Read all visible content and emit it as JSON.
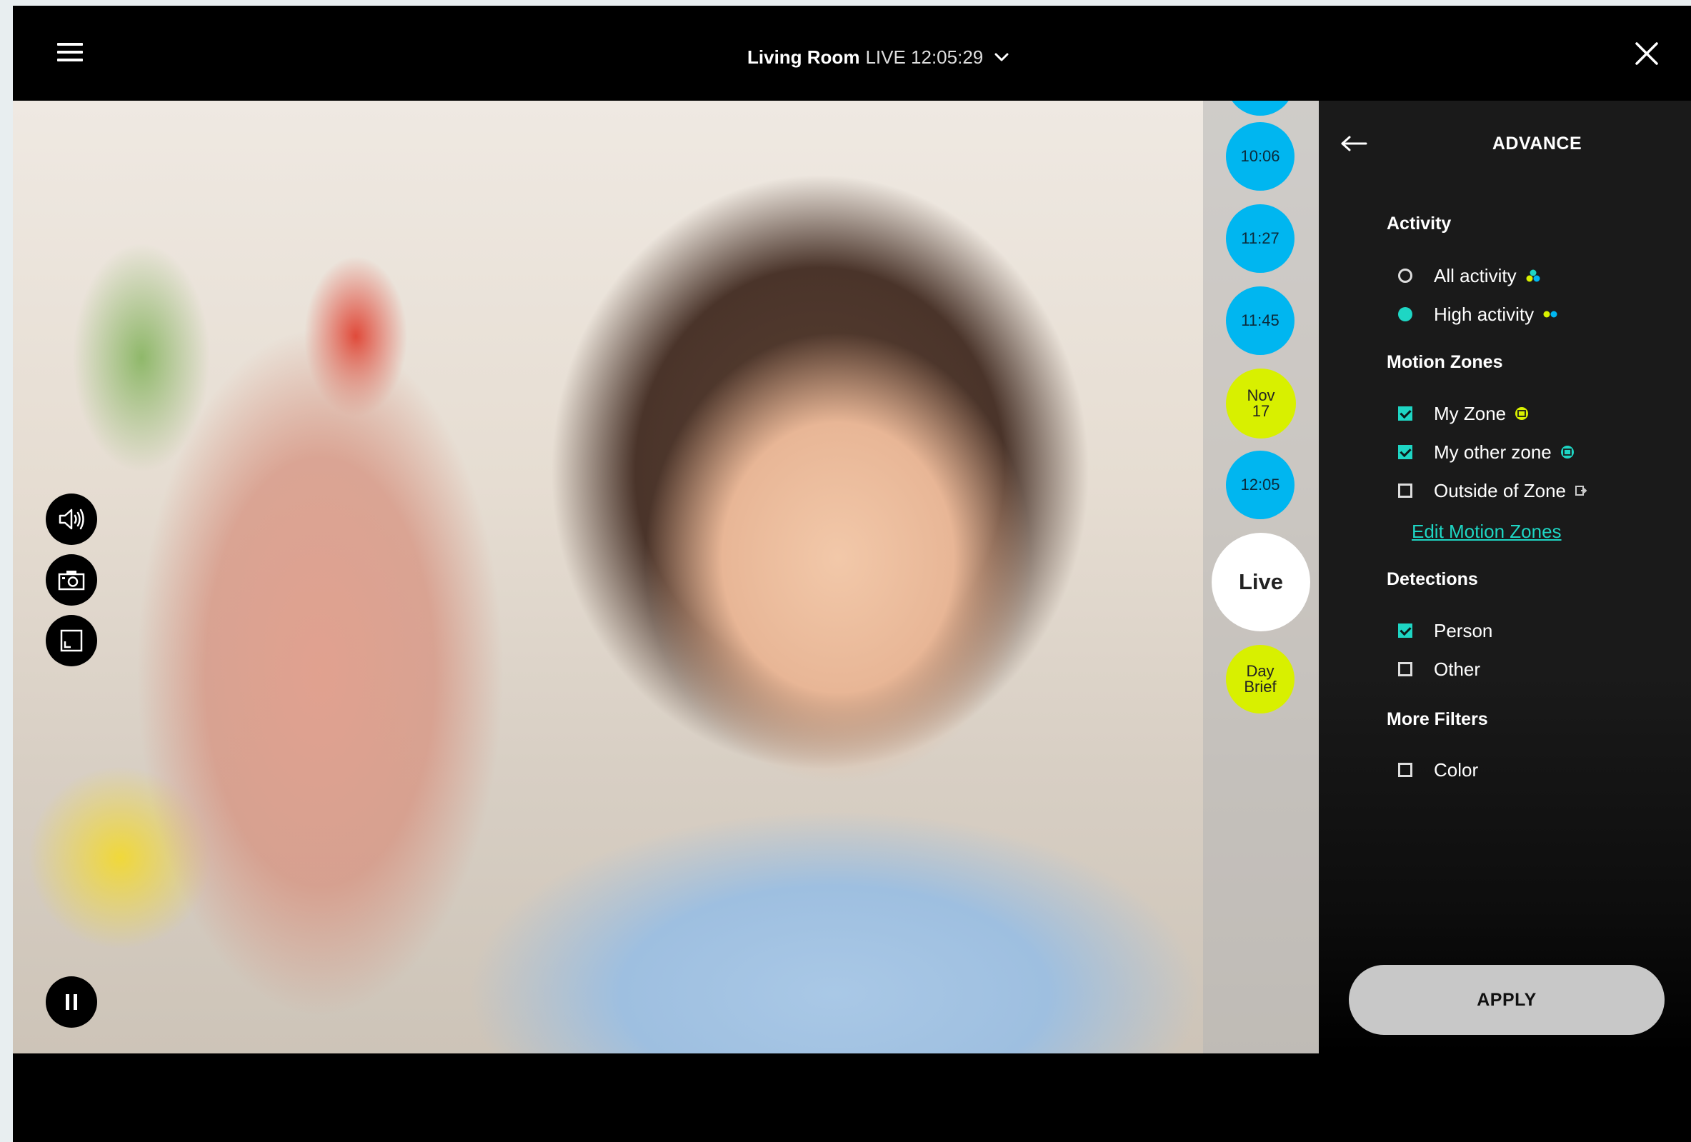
{
  "header": {
    "camera_name": "Living Room",
    "live_status": "LIVE 12:05:29"
  },
  "timeline": {
    "bubbles": [
      {
        "label": "10:06",
        "kind": "event"
      },
      {
        "label": "11:27",
        "kind": "event"
      },
      {
        "label": "11:45",
        "kind": "event"
      },
      {
        "label": "Nov 17",
        "kind": "date"
      },
      {
        "label": "12:05",
        "kind": "event"
      },
      {
        "label": "Live",
        "kind": "live"
      },
      {
        "label": "Day Brief",
        "kind": "brief"
      }
    ]
  },
  "controls": {
    "volume": "speaker-icon",
    "snapshot": "camera-icon",
    "fullscreen": "fullscreen-icon",
    "pause": "pause-icon"
  },
  "panel": {
    "title": "ADVANCE",
    "activity": {
      "title": "Activity",
      "options": [
        {
          "label": "All activity",
          "selected": false
        },
        {
          "label": "High activity",
          "selected": true
        }
      ]
    },
    "motion_zones": {
      "title": "Motion Zones",
      "options": [
        {
          "label": "My Zone",
          "checked": true,
          "icon_color": "#d8f000"
        },
        {
          "label": "My other zone",
          "checked": true,
          "icon_color": "#1ed6c4"
        },
        {
          "label": "Outside of Zone",
          "checked": false
        }
      ],
      "edit_link": "Edit Motion Zones"
    },
    "detections": {
      "title": "Detections",
      "options": [
        {
          "label": "Person",
          "checked": true
        },
        {
          "label": "Other",
          "checked": false
        }
      ]
    },
    "more_filters": {
      "title": "More Filters",
      "options": [
        {
          "label": "Color",
          "checked": false
        }
      ]
    },
    "apply_label": "APPLY"
  },
  "colors": {
    "accent": "#1ed6c4",
    "event_blue": "#00b6f0",
    "date_yellow": "#d8f000"
  }
}
